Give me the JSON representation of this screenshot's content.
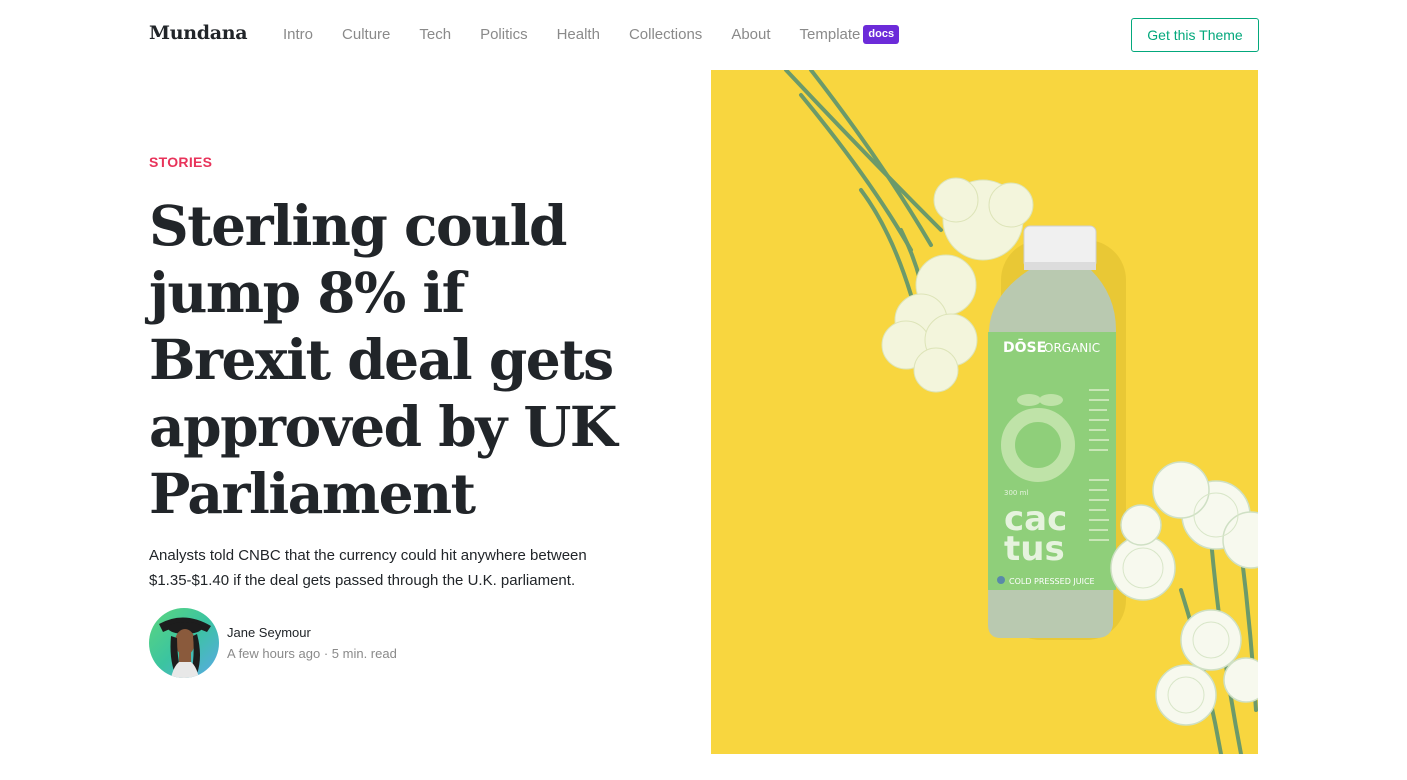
{
  "brand": "Mundana",
  "nav": {
    "items": [
      {
        "label": "Intro"
      },
      {
        "label": "Culture"
      },
      {
        "label": "Tech"
      },
      {
        "label": "Politics"
      },
      {
        "label": "Health"
      },
      {
        "label": "Collections"
      },
      {
        "label": "About"
      },
      {
        "label": "Template"
      }
    ],
    "badge": "docs",
    "cta": "Get this Theme"
  },
  "hero": {
    "category": "STORIES",
    "title": "Sterling could jump 8% if Brexit deal gets approved by UK Parliament",
    "summary": "Analysts told CNBC that the currency could hit anywhere between $1.35-$1.40 if the deal gets passed through the U.K. parliament.",
    "author": "Jane Seymour",
    "meta": "A few hours ago · 5 min. read"
  },
  "image": {
    "brand_a": "DŌSE",
    "brand_b": "ORGANIC",
    "product_a": "cac",
    "product_b": "tus",
    "footer": "COLD PRESSED JUICE",
    "volume": "300 ml"
  },
  "colors": {
    "accent": "#03a87c",
    "category": "#e8335a",
    "badge": "#6c2bd9",
    "image_background": "#f8d63f",
    "label": "#8fcf7a"
  }
}
